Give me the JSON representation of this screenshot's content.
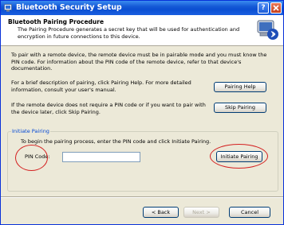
{
  "window": {
    "title": "Bluetooth Security Setup",
    "help_button": "?",
    "close_button": "X"
  },
  "header": {
    "title": "Bluetooth Pairing Procedure",
    "description": "The Pairing Procedure generates a secret key that will be used for authentication and encryption in future connections to this device.",
    "icon": "bluetooth-computer-icon"
  },
  "content": {
    "intro": "To pair with a remote device, the remote device must be in pairable mode and you must know the PIN code. For information about the PIN code of the remote device, refer to that device's documentation.",
    "help_text": "For a brief description of pairing, click Pairing Help. For more detailed information, consult your user's manual.",
    "help_button": "Pairing Help",
    "skip_text": "If the remote device does not require a PIN code or if you want to pair with the device later, click Skip Pairing.",
    "skip_button": "Skip Pairing"
  },
  "initiate": {
    "group_label": "Initiate Pairing",
    "instructions": "To begin the pairing process, enter the PIN code and click Initiate Pairing.",
    "pin_label": "PIN Code:",
    "pin_value": "",
    "initiate_button": "Initiate Pairing"
  },
  "footer": {
    "back_button": "< Back",
    "next_button": "Next >",
    "cancel_button": "Cancel"
  },
  "colors": {
    "titlebar": "#0b4fd2",
    "dialog_bg": "#ece9d8",
    "annotation_ring": "#d42020",
    "group_label": "#0046d5"
  }
}
